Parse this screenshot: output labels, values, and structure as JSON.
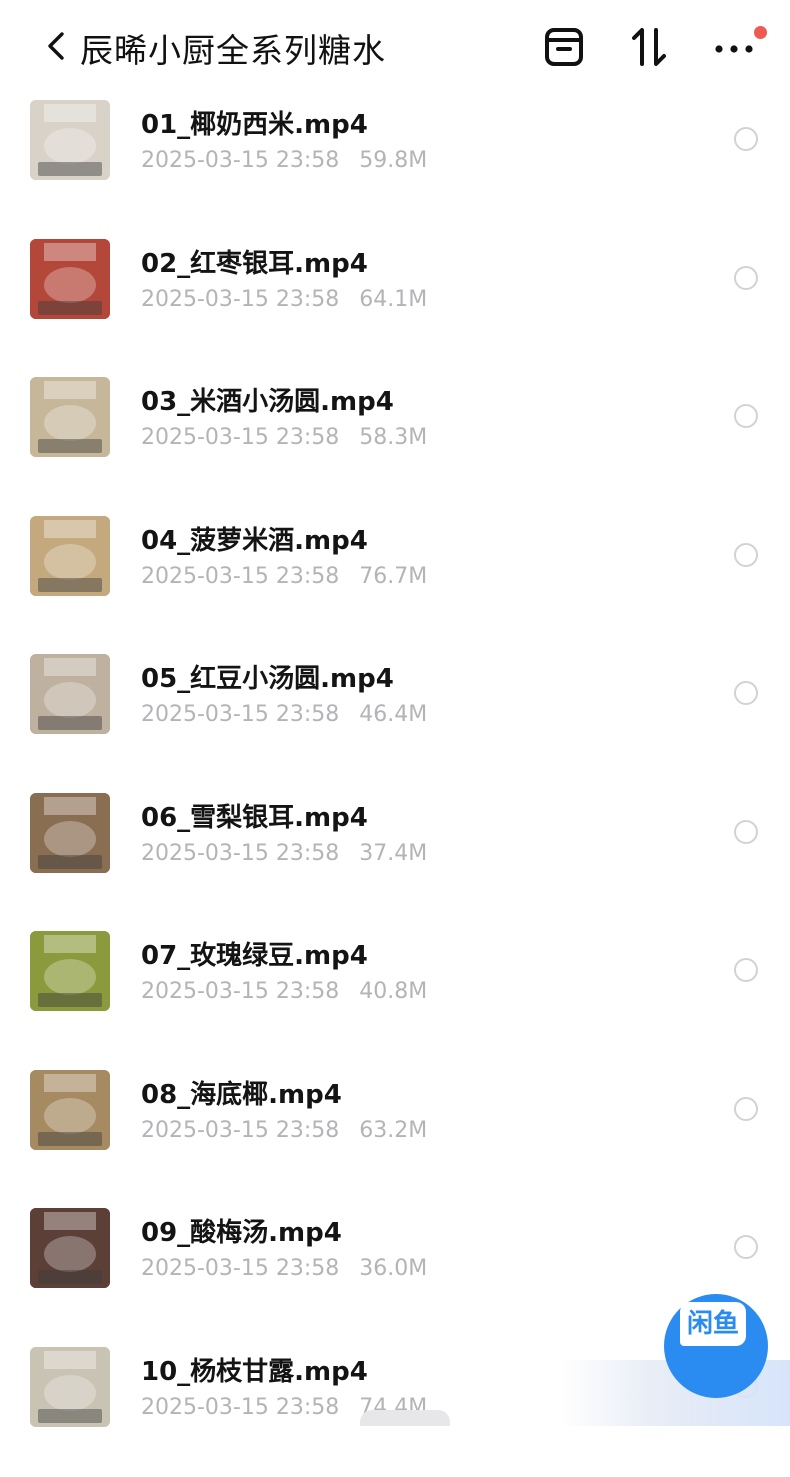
{
  "header": {
    "title": "辰晞小厨全系列糖水",
    "back_icon": "chevron-left-icon",
    "icons": [
      "archive-box-icon",
      "sort-icon",
      "more-icon"
    ],
    "notification_dot_color": "#f05a55"
  },
  "files": [
    {
      "name": "01_椰奶西米.mp4",
      "date": "2025-03-15 23:58",
      "size": "59.8M",
      "thumb_color": "#d8d2c8"
    },
    {
      "name": "02_红枣银耳.mp4",
      "date": "2025-03-15 23:58",
      "size": "64.1M",
      "thumb_color": "#b3473a"
    },
    {
      "name": "03_米酒小汤圆.mp4",
      "date": "2025-03-15 23:58",
      "size": "58.3M",
      "thumb_color": "#c7b79a"
    },
    {
      "name": "04_菠萝米酒.mp4",
      "date": "2025-03-15 23:58",
      "size": "76.7M",
      "thumb_color": "#c4a97f"
    },
    {
      "name": "05_红豆小汤圆.mp4",
      "date": "2025-03-15 23:58",
      "size": "46.4M",
      "thumb_color": "#bfb1a0"
    },
    {
      "name": "06_雪梨银耳.mp4",
      "date": "2025-03-15 23:58",
      "size": "37.4M",
      "thumb_color": "#8a6e52"
    },
    {
      "name": "07_玫瑰绿豆.mp4",
      "date": "2025-03-15 23:58",
      "size": "40.8M",
      "thumb_color": "#8a9a3c"
    },
    {
      "name": "08_海底椰.mp4",
      "date": "2025-03-15 23:58",
      "size": "63.2M",
      "thumb_color": "#a58a62"
    },
    {
      "name": "09_酸梅汤.mp4",
      "date": "2025-03-15 23:58",
      "size": "36.0M",
      "thumb_color": "#5c4038"
    },
    {
      "name": "10_杨枝甘露.mp4",
      "date": "2025-03-15 23:58",
      "size": "74.4M",
      "thumb_color": "#c9c3b4"
    }
  ],
  "floating_badge": {
    "label": "闲鱼",
    "color": "#2a8cf0"
  }
}
